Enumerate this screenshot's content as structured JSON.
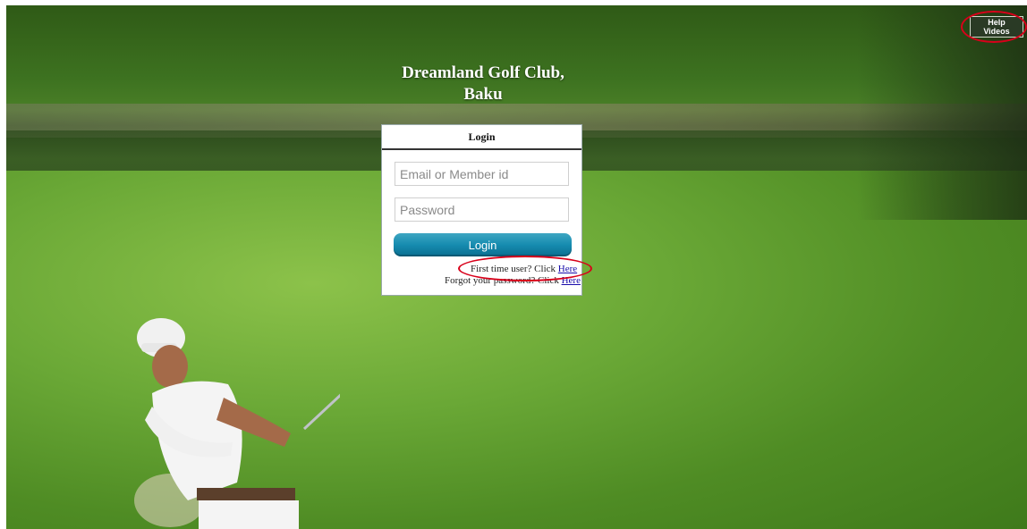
{
  "header": {
    "title_line1": "Dreamland Golf Club,",
    "title_line2": "Baku"
  },
  "help_button": {
    "label": "Help Videos"
  },
  "login": {
    "heading": "Login",
    "email_placeholder": "Email or Member id",
    "password_placeholder": "Password",
    "submit_label": "Login",
    "first_time_text": "First time user? Click ",
    "first_time_link": "Here",
    "forgot_text": "Forgot your password? Click ",
    "forgot_link": "Here"
  },
  "colors": {
    "annotation": "#d8001a",
    "button_accent": "#168cb0",
    "link": "#1a0dab"
  }
}
